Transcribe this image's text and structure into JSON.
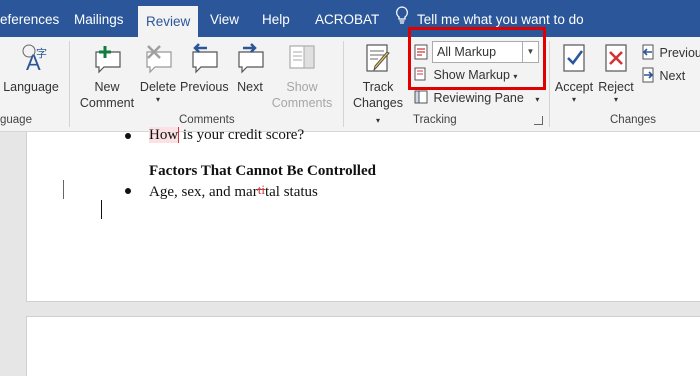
{
  "tabs": [
    {
      "label": "eferences"
    },
    {
      "label": "Mailings"
    },
    {
      "label": "Review"
    },
    {
      "label": "View"
    },
    {
      "label": "Help"
    },
    {
      "label": "ACROBAT"
    }
  ],
  "tell_me": "Tell me what you want to do",
  "ribbon": {
    "language": {
      "label": "Language",
      "group": "guage"
    },
    "comments": {
      "group": "Comments",
      "new_line1": "New",
      "new_line2": "Comment",
      "delete": "Delete",
      "previous": "Previous",
      "next": "Next",
      "show_line1": "Show",
      "show_line2": "Comments"
    },
    "tracking": {
      "group": "Tracking",
      "track_line1": "Track",
      "track_line2": "Changes",
      "markup_select": "All Markup",
      "show_markup": "Show Markup",
      "reviewing_pane": "Reviewing Pane"
    },
    "changes": {
      "group": "Changes",
      "accept": "Accept",
      "reject": "Reject",
      "previous": "Previous",
      "next": "Next"
    }
  },
  "document": {
    "line1_inserted": "How",
    "line1_rest": " is your credit score?",
    "heading": "Factors That Cannot Be Controlled",
    "line2_a": "Age, sex, and mar",
    "line2_deleted": "ti",
    "line2_b": "tal status"
  },
  "colors": {
    "ribbon_tab_bar": "#2b579a",
    "highlight_box": "#e00000",
    "comment_accent": "#107c41",
    "track_red": "#d13438"
  }
}
